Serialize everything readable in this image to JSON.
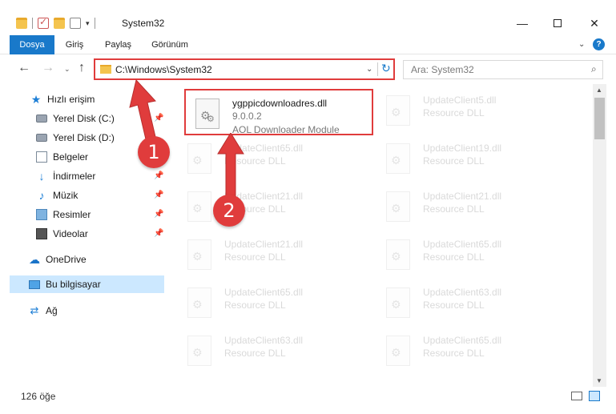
{
  "window": {
    "title": "System32",
    "minimize_label": "—",
    "close_label": "✕"
  },
  "ribbon": {
    "tabs": [
      {
        "label": "Dosya"
      },
      {
        "label": "Giriş"
      },
      {
        "label": "Paylaş"
      },
      {
        "label": "Görünüm"
      }
    ],
    "collapse_label": "⌄",
    "help_label": "?"
  },
  "nav": {
    "back_label": "←",
    "forward_label": "→",
    "recent_label": "⌄",
    "up_label": "↑",
    "address": "C:\\Windows\\System32",
    "address_dropdown": "⌄",
    "refresh_label": "↻",
    "search_placeholder": "Ara: System32",
    "search_icon": "⌕"
  },
  "sidebar": {
    "items": [
      {
        "label": "Hızlı erişim",
        "icon": "star-icon",
        "glyph": "★"
      },
      {
        "label": "Yerel Disk (C:)",
        "icon": "drive-icon"
      },
      {
        "label": "Yerel Disk (D:)",
        "icon": "drive-icon"
      },
      {
        "label": "Belgeler",
        "icon": "documents-icon"
      },
      {
        "label": "İndirmeler",
        "icon": "downloads-icon",
        "glyph": "↓"
      },
      {
        "label": "Müzik",
        "icon": "music-icon",
        "glyph": "♪"
      },
      {
        "label": "Resimler",
        "icon": "pictures-icon"
      },
      {
        "label": "Videolar",
        "icon": "videos-icon"
      },
      {
        "label": "OneDrive",
        "icon": "cloud-icon",
        "glyph": "☁"
      },
      {
        "label": "Bu bilgisayar",
        "icon": "computer-icon"
      },
      {
        "label": "Ağ",
        "icon": "network-icon",
        "glyph": "⇄"
      }
    ],
    "pin_glyph": "📌"
  },
  "files": [
    {
      "name": "ygppicdownloadres.dll",
      "version": "9.0.0.2",
      "description": "AOL Downloader Module",
      "highlighted": true
    },
    {
      "name": "UpdateClient5.dll",
      "description": "Resource DLL"
    },
    {
      "name": "UpdateClient65.dll",
      "description": "Resource DLL"
    },
    {
      "name": "UpdateClient19.dll",
      "description": "Resource DLL"
    },
    {
      "name": "UpdateClient21.dll",
      "description": "Resource DLL"
    },
    {
      "name": "UpdateClient21.dll",
      "description": "Resource DLL"
    },
    {
      "name": "UpdateClient21.dll",
      "description": "Resource DLL"
    },
    {
      "name": "UpdateClient65.dll",
      "description": "Resource DLL"
    },
    {
      "name": "UpdateClient65.dll",
      "description": "Resource DLL"
    },
    {
      "name": "UpdateClient63.dll",
      "description": "Resource DLL"
    },
    {
      "name": "UpdateClient63.dll",
      "description": "Resource DLL"
    },
    {
      "name": "UpdateClient65.dll",
      "description": "Resource DLL"
    }
  ],
  "status": {
    "item_count": "126 öğe"
  },
  "annotations": {
    "step1": "1",
    "step2": "2",
    "color": "#e03c3c"
  },
  "colors": {
    "accent": "#1979ca",
    "selection": "#cce8ff",
    "highlight": "#e03c3c"
  }
}
